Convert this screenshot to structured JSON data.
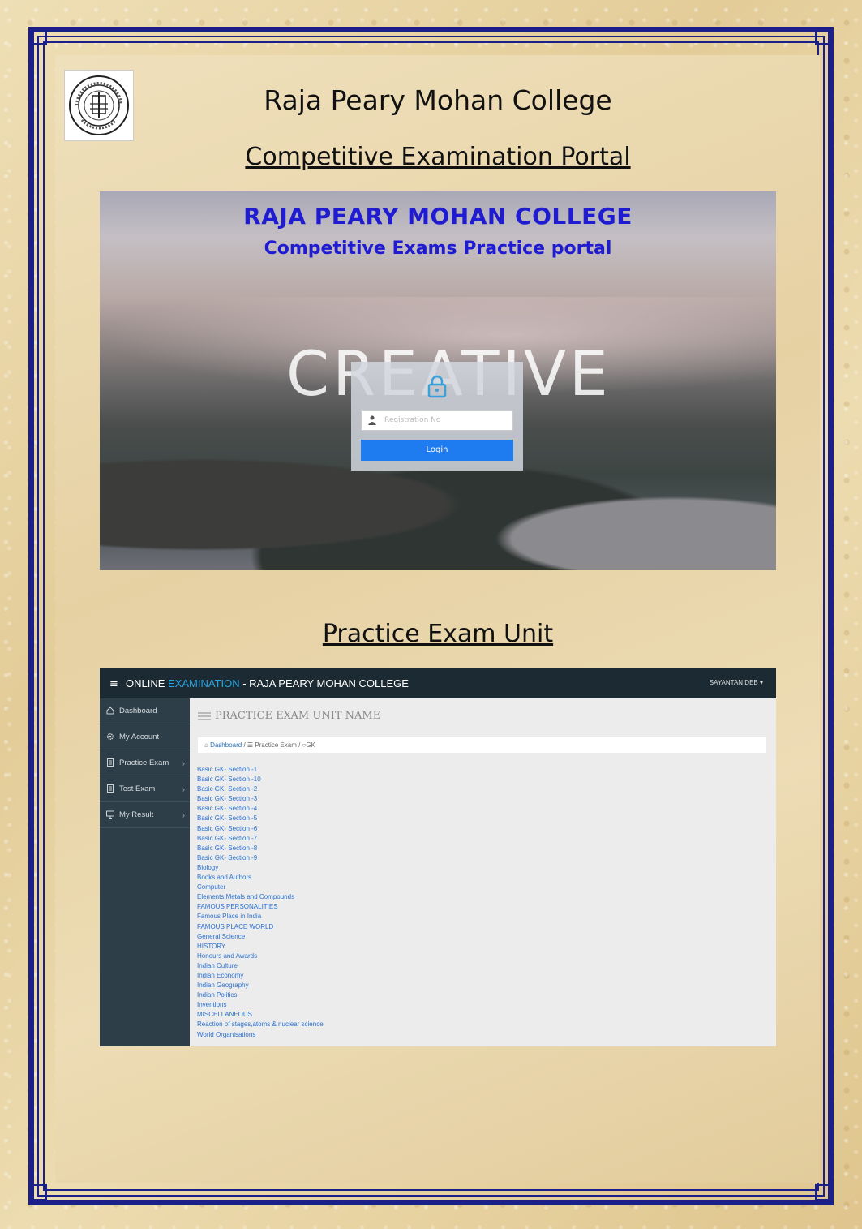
{
  "header": {
    "title": "Raja Peary Mohan College",
    "subtitle": "Competitive Examination Portal",
    "logo_text": "RAJA PEARY MOHAN COLLEGE UTTARPARA"
  },
  "login_screen": {
    "heading": "RAJA PEARY MOHAN COLLEGE",
    "subheading": "Competitive Exams Practice portal",
    "background_word": "CREATIVE",
    "input_placeholder": "Registration No",
    "login_button": "Login"
  },
  "practice_section": {
    "title": "Practice Exam Unit"
  },
  "practice_app": {
    "title_part1": "ONLINE ",
    "title_accent": "EXAMINATION",
    "title_part2": " - RAJA PEARY MOHAN COLLEGE",
    "user": "SAYANTAN DEB",
    "user_caret": "▾",
    "sidebar": [
      {
        "label": "Dashboard",
        "icon": "home-icon"
      },
      {
        "label": "My Account",
        "icon": "gear-icon"
      },
      {
        "label": "Practice Exam",
        "icon": "document-icon",
        "chevron": "›"
      },
      {
        "label": "Test Exam",
        "icon": "document-icon",
        "chevron": "›"
      },
      {
        "label": "My Result",
        "icon": "monitor-icon",
        "chevron": "›"
      }
    ],
    "page_heading": "PRACTICE EXAM UNIT NAME",
    "breadcrumb": {
      "home": "Dashboard",
      "sep": " / ",
      "middle": "Practice Exam",
      "current": "GK"
    },
    "exam_units": [
      "Basic GK- Section -1",
      "Basic GK- Section -10",
      "Basic GK- Section -2",
      "Basic GK- Section -3",
      "Basic GK- Section -4",
      "Basic GK- Section -5",
      "Basic GK- Section -6",
      "Basic GK- Section -7",
      "Basic GK- Section -8",
      "Basic GK- Section -9",
      "Biology",
      "Books and Authors",
      "Computer",
      "Elements,Metals and Compounds",
      "FAMOUS PERSONALITIES",
      "Famous Place in India",
      "FAMOUS PLACE WORLD",
      "General Science",
      "HISTORY",
      "Honours and Awards",
      "Indian Culture",
      "Indian Economy",
      "Indian Geography",
      "Indian Politics",
      "Inventions",
      "MISCELLANEOUS",
      "Reaction of stages,atoms & nuclear science",
      "World Organisations"
    ]
  },
  "colors": {
    "frame": "#1a1f8a",
    "login_heading": "#1f1bd0",
    "login_button": "#1e7cf0",
    "topbar": "#1c2b33",
    "sidebar": "#2e3e48",
    "accent": "#29a3e0",
    "link": "#2a72d0"
  }
}
